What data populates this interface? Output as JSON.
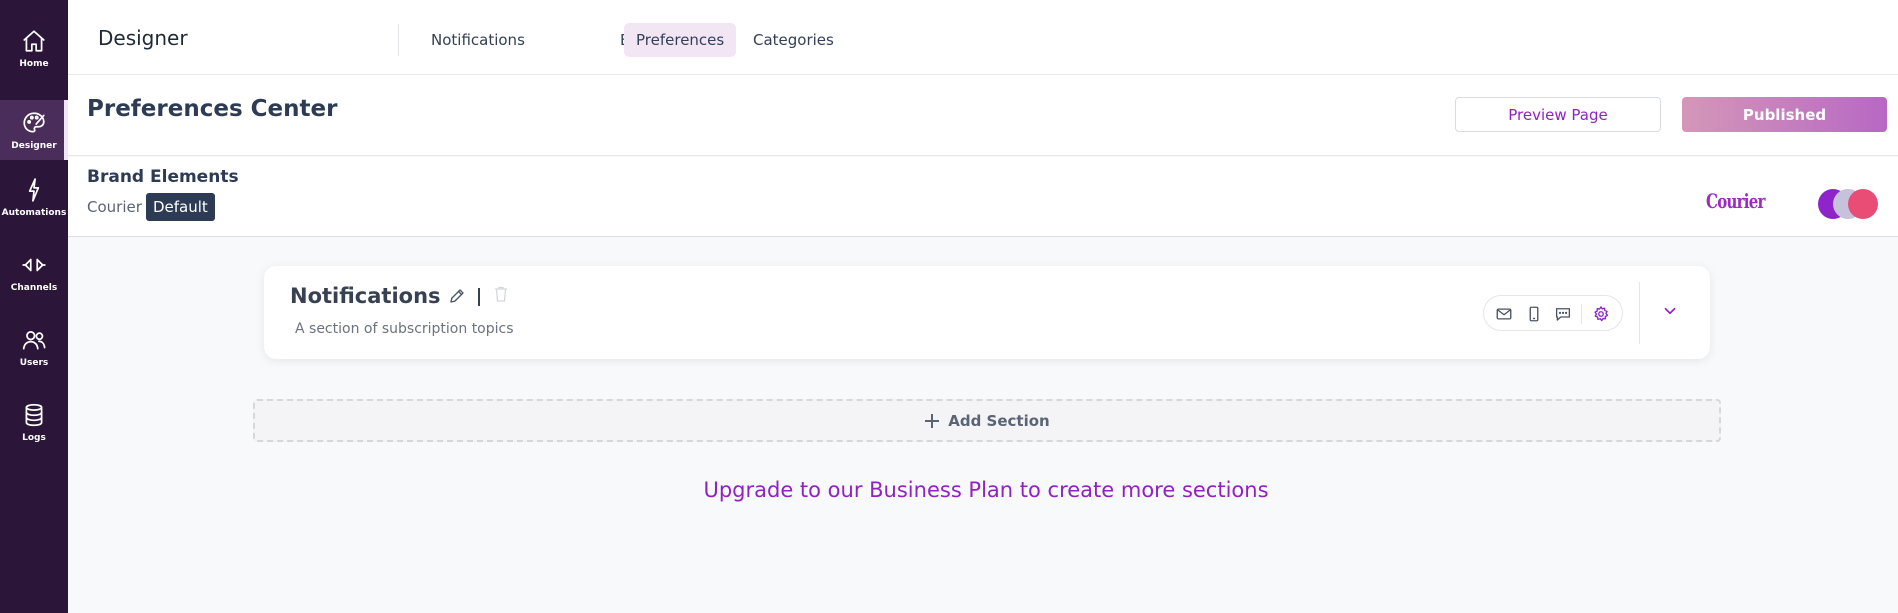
{
  "sidebar": {
    "items": [
      {
        "label": "Home",
        "icon": "home-icon"
      },
      {
        "label": "Designer",
        "icon": "palette-icon"
      },
      {
        "label": "Automations",
        "icon": "lightning-icon"
      },
      {
        "label": "Channels",
        "icon": "channels-icon"
      },
      {
        "label": "Users",
        "icon": "users-icon"
      },
      {
        "label": "Logs",
        "icon": "database-icon"
      }
    ],
    "active": "Designer"
  },
  "topbar": {
    "title": "Designer",
    "tabs": [
      {
        "label": "Notifications"
      },
      {
        "label": "Brands"
      },
      {
        "label": "Preferences"
      },
      {
        "label": "Categories"
      }
    ],
    "active_tab": "Preferences"
  },
  "header": {
    "title": "Preferences Center",
    "preview_label": "Preview Page",
    "published_label": "Published"
  },
  "brand": {
    "title": "Brand Elements",
    "name": "Courier",
    "badge": "Default",
    "logo_text": "Courier",
    "colors": [
      "#8e24c9",
      "#c6c2dc",
      "#e94c75"
    ]
  },
  "section": {
    "title": "Notifications",
    "description": "A section of subscription topics",
    "channel_icons": [
      "email-icon",
      "mobile-icon",
      "chat-icon",
      "settings-icon"
    ]
  },
  "add_section_label": "Add Section",
  "upgrade_text": "Upgrade to our Business Plan to create more sections",
  "colors": {
    "sidebar_bg": "#2b1538",
    "accent": "#9121c2",
    "active_tab_bg": "#f2e6f5"
  }
}
